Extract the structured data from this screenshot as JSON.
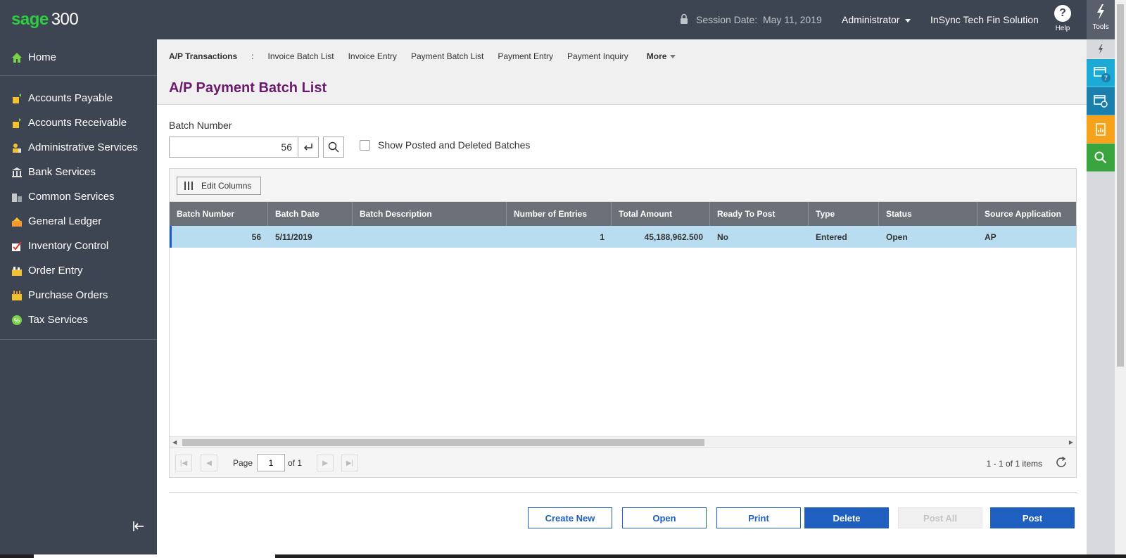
{
  "app": {
    "brand": "sage",
    "version": "300"
  },
  "header": {
    "session_label": "Session Date:",
    "session_date": "May 11, 2019",
    "user": "Administrator",
    "company": "InSync Tech Fin Solution",
    "help_label": "Help",
    "tools_label": "Tools"
  },
  "rail": {
    "window_count": "7",
    "colors": {
      "window": "#1ba9d6",
      "window2": "#1a7fad",
      "report": "#f7a21b",
      "search": "#3aa53e"
    }
  },
  "sidebar": {
    "home": "Home",
    "items": [
      {
        "label": "Accounts Payable",
        "icon": "accounts-payable-icon"
      },
      {
        "label": "Accounts Receivable",
        "icon": "accounts-receivable-icon"
      },
      {
        "label": "Administrative Services",
        "icon": "administrative-services-icon"
      },
      {
        "label": "Bank Services",
        "icon": "bank-icon"
      },
      {
        "label": "Common Services",
        "icon": "common-services-icon"
      },
      {
        "label": "General Ledger",
        "icon": "general-ledger-icon"
      },
      {
        "label": "Inventory Control",
        "icon": "inventory-control-icon"
      },
      {
        "label": "Order Entry",
        "icon": "order-entry-icon"
      },
      {
        "label": "Purchase Orders",
        "icon": "purchase-orders-icon"
      },
      {
        "label": "Tax Services",
        "icon": "tax-services-icon"
      }
    ]
  },
  "subnav": {
    "section": "A/P Transactions",
    "links": [
      "Invoice Batch List",
      "Invoice Entry",
      "Payment Batch List",
      "Payment Entry",
      "Payment Inquiry"
    ],
    "more": "More"
  },
  "page": {
    "title": "A/P Payment Batch List",
    "batch_number_label": "Batch Number",
    "batch_number_value": "56",
    "show_posted_label": "Show Posted and Deleted Batches"
  },
  "grid": {
    "edit_columns_label": "Edit Columns",
    "columns": [
      "Batch Number",
      "Batch Date",
      "Batch Description",
      "Number of Entries",
      "Total Amount",
      "Ready To Post",
      "Type",
      "Status",
      "Source Application"
    ],
    "rows": [
      [
        "56",
        "5/11/2019",
        "",
        "1",
        "45,188,962.500",
        "No",
        "Entered",
        "Open",
        "AP"
      ]
    ],
    "page_label": "Page",
    "page_value": "1",
    "page_of": "of 1",
    "items_info": "1 - 1 of 1 items"
  },
  "buttons": {
    "create_new": "Create New",
    "open": "Open",
    "print": "Print",
    "delete": "Delete",
    "post_all": "Post All",
    "post": "Post"
  }
}
